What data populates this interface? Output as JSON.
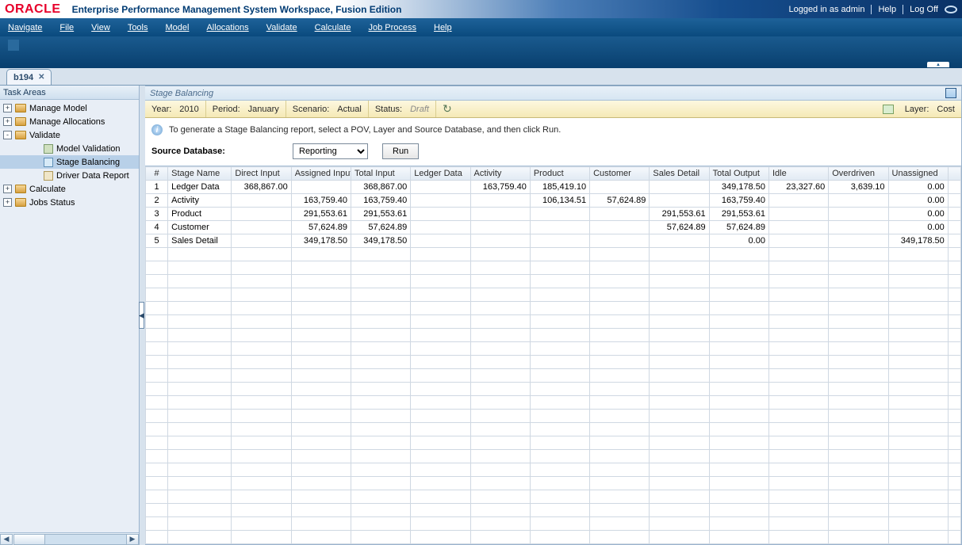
{
  "header": {
    "logo_text": "ORACLE",
    "app_title": "Enterprise Performance Management System Workspace, Fusion Edition",
    "logged_in": "Logged in as admin",
    "help": "Help",
    "logoff": "Log Off"
  },
  "menu": [
    "Navigate",
    "File",
    "View",
    "Tools",
    "Model",
    "Allocations",
    "Validate",
    "Calculate",
    "Job Process",
    "Help"
  ],
  "tab": {
    "label": "b194"
  },
  "task_areas": {
    "title": "Task Areas",
    "nodes": [
      {
        "expander": "+",
        "label": "Manage Model",
        "kind": "folder"
      },
      {
        "expander": "+",
        "label": "Manage Allocations",
        "kind": "folder"
      },
      {
        "expander": "-",
        "label": "Validate",
        "kind": "folder",
        "children": [
          {
            "label": "Model Validation",
            "kind": "leaf"
          },
          {
            "label": "Stage Balancing",
            "kind": "stage",
            "selected": true
          },
          {
            "label": "Driver Data Report",
            "kind": "drv"
          }
        ]
      },
      {
        "expander": "+",
        "label": "Calculate",
        "kind": "folder"
      },
      {
        "expander": "+",
        "label": "Jobs Status",
        "kind": "folder"
      }
    ]
  },
  "content": {
    "title": "Stage Balancing",
    "pov": {
      "year_label": "Year",
      "year": "2010",
      "period_label": "Period",
      "period": "January",
      "scenario_label": "Scenario",
      "scenario": "Actual",
      "status_label": "Status",
      "status": "Draft",
      "layer_label": "Layer",
      "layer": "Cost"
    },
    "hint": "To generate a Stage Balancing report, select a POV, Layer and Source Database, and then click Run.",
    "source_db_label": "Source Database:",
    "source_db_selected": "Reporting",
    "run_label": "Run"
  },
  "grid": {
    "columns": [
      "#",
      "Stage Name",
      "Direct Input",
      "Assigned Input",
      "Total Input",
      "Ledger Data",
      "Activity",
      "Product",
      "Customer",
      "Sales Detail",
      "Total Output",
      "Idle",
      "Overdriven",
      "Unassigned"
    ],
    "rows": [
      {
        "idx": "1",
        "name": "Ledger Data",
        "direct": "368,867.00",
        "assigned": "",
        "total_in": "368,867.00",
        "ledger": "",
        "activity": "163,759.40",
        "product": "185,419.10",
        "customer": "",
        "sales": "",
        "total_out": "349,178.50",
        "idle": "23,327.60",
        "over": "3,639.10",
        "unassigned": "0.00"
      },
      {
        "idx": "2",
        "name": "Activity",
        "direct": "",
        "assigned": "163,759.40",
        "total_in": "163,759.40",
        "ledger": "",
        "activity": "",
        "product": "106,134.51",
        "customer": "57,624.89",
        "sales": "",
        "total_out": "163,759.40",
        "idle": "",
        "over": "",
        "unassigned": "0.00"
      },
      {
        "idx": "3",
        "name": "Product",
        "direct": "",
        "assigned": "291,553.61",
        "total_in": "291,553.61",
        "ledger": "",
        "activity": "",
        "product": "",
        "customer": "",
        "sales": "291,553.61",
        "total_out": "291,553.61",
        "idle": "",
        "over": "",
        "unassigned": "0.00"
      },
      {
        "idx": "4",
        "name": "Customer",
        "direct": "",
        "assigned": "57,624.89",
        "total_in": "57,624.89",
        "ledger": "",
        "activity": "",
        "product": "",
        "customer": "",
        "sales": "57,624.89",
        "total_out": "57,624.89",
        "idle": "",
        "over": "",
        "unassigned": "0.00"
      },
      {
        "idx": "5",
        "name": "Sales Detail",
        "direct": "",
        "assigned": "349,178.50",
        "total_in": "349,178.50",
        "ledger": "",
        "activity": "",
        "product": "",
        "customer": "",
        "sales": "",
        "total_out": "0.00",
        "idle": "",
        "over": "",
        "unassigned": "349,178.50"
      }
    ]
  }
}
